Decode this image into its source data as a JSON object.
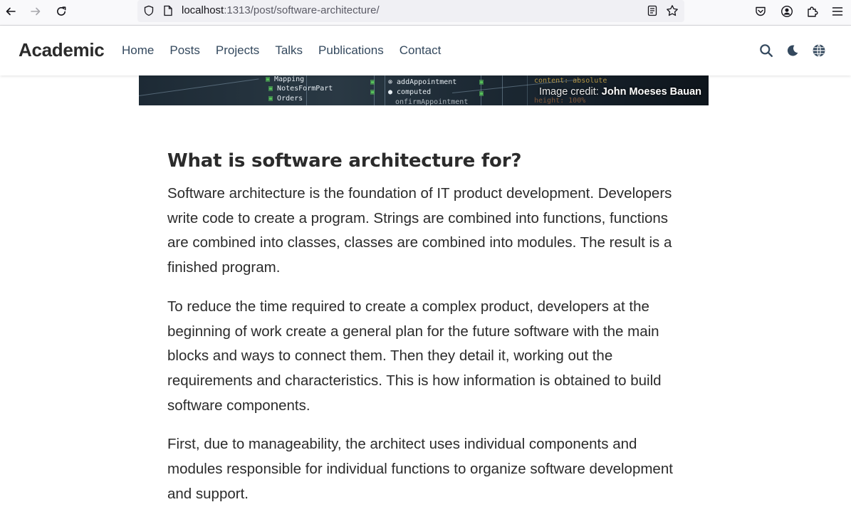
{
  "browser": {
    "url_host": "localhost",
    "url_rest": ":1313/post/software-architecture/",
    "back_icon": "arrow-left-icon",
    "forward_icon": "arrow-right-icon",
    "reload_icon": "reload-icon"
  },
  "site": {
    "brand": "Academic",
    "nav": [
      {
        "label": "Home"
      },
      {
        "label": "Posts"
      },
      {
        "label": "Projects"
      },
      {
        "label": "Talks"
      },
      {
        "label": "Publications"
      },
      {
        "label": "Contact"
      }
    ]
  },
  "hero": {
    "credit_prefix": "Image credit: ",
    "credit_author": "John Moeses Bauan"
  },
  "article": {
    "heading": "What is software architecture for?",
    "paragraphs": [
      "Software architecture is the foundation of IT product development. Developers write code to create a program. Strings are combined into functions, functions are combined into classes, classes are combined into modules. The result is a finished program.",
      "To reduce the time required to create a complex product, developers at the beginning of work create a general plan for the future software with the main blocks and ways to connect them. Then they detail it, working out the requirements and characteristics. This is how information is obtained to build software components.",
      "First, due to manageability, the architect uses individual components and modules responsible for individual functions to organize software development and support."
    ]
  }
}
